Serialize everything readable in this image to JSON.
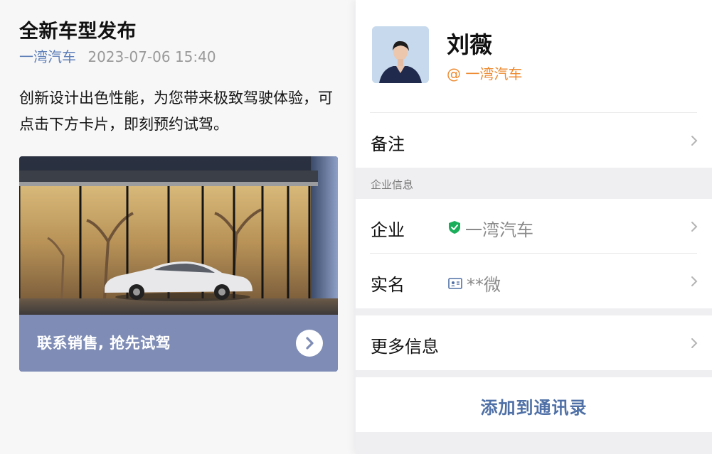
{
  "post": {
    "title": "全新车型发布",
    "org": "一湾汽车",
    "time": "2023-07-06 15:40",
    "body": "创新设计出色性能，为您带来极致驾驶体验，可点击下方卡片，即刻预约试驾。",
    "card": {
      "image_icon": "car-showroom-image",
      "label": "联系销售, 抢先试驾",
      "arrow_icon": "chevron-right-icon"
    }
  },
  "contact": {
    "name": "刘薇",
    "org_tag": "@ 一湾汽车",
    "avatar_icon": "avatar-photo",
    "rows": {
      "remark": {
        "label": "备注"
      },
      "section_label": "企业信息",
      "enterprise": {
        "label": "企业",
        "value": "一湾汽车",
        "icon": "verified-shield-icon"
      },
      "realname": {
        "label": "实名",
        "value": "**微",
        "icon": "id-card-icon"
      },
      "more": {
        "label": "更多信息"
      }
    },
    "add_button": "添加到通讯录"
  },
  "colors": {
    "accent_blue": "#4f70a6",
    "org_blue": "#5e7fb8",
    "orange": "#ee8a30",
    "card_footer": "#7f8db6",
    "verified_green": "#1aad5a"
  }
}
